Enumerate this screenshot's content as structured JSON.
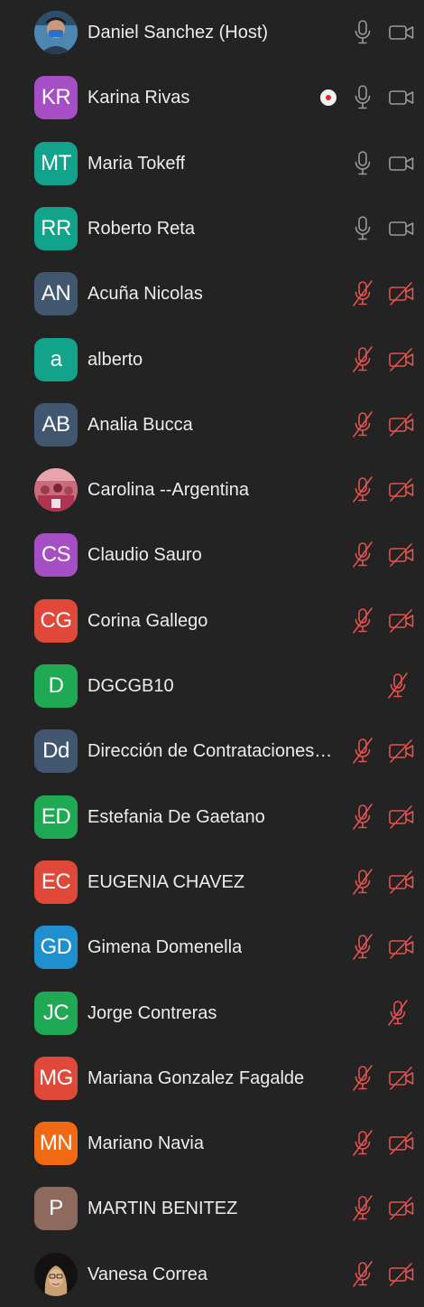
{
  "participants": [
    {
      "name": "Daniel Sanchez (Host)",
      "initials": "",
      "avatar": "photo",
      "color": "#3a6a8a",
      "muted": false,
      "video_off": false,
      "has_video": true,
      "recording": false
    },
    {
      "name": "Karina Rivas",
      "initials": "KR",
      "avatar": "initials",
      "color": "#a64fc4",
      "muted": false,
      "video_off": false,
      "has_video": true,
      "recording": true
    },
    {
      "name": "Maria Tokeff",
      "initials": "MT",
      "avatar": "initials",
      "color": "#12a38a",
      "muted": false,
      "video_off": false,
      "has_video": true,
      "recording": false
    },
    {
      "name": "Roberto Reta",
      "initials": "RR",
      "avatar": "initials",
      "color": "#12a38a",
      "muted": false,
      "video_off": false,
      "has_video": true,
      "recording": false
    },
    {
      "name": "Acuña Nicolas",
      "initials": "AN",
      "avatar": "initials",
      "color": "#41566f",
      "muted": true,
      "video_off": true,
      "has_video": true,
      "recording": false
    },
    {
      "name": "alberto",
      "initials": "a",
      "avatar": "initials",
      "color": "#12a38a",
      "muted": true,
      "video_off": true,
      "has_video": true,
      "recording": false
    },
    {
      "name": "Analia Bucca",
      "initials": "AB",
      "avatar": "initials",
      "color": "#41566f",
      "muted": true,
      "video_off": true,
      "has_video": true,
      "recording": false
    },
    {
      "name": "Carolina --Argentina",
      "initials": "",
      "avatar": "photo",
      "color": "#b3475f",
      "muted": true,
      "video_off": true,
      "has_video": true,
      "recording": false
    },
    {
      "name": "Claudio Sauro",
      "initials": "CS",
      "avatar": "initials",
      "color": "#a64fc4",
      "muted": true,
      "video_off": true,
      "has_video": true,
      "recording": false
    },
    {
      "name": "Corina Gallego",
      "initials": "CG",
      "avatar": "initials",
      "color": "#e0483a",
      "muted": true,
      "video_off": true,
      "has_video": true,
      "recording": false
    },
    {
      "name": "DGCGB10",
      "initials": "D",
      "avatar": "initials",
      "color": "#1fa955",
      "muted": true,
      "video_off": true,
      "has_video": false,
      "recording": false
    },
    {
      "name": "Dirección de Contrataciones…",
      "initials": "Dd",
      "avatar": "initials",
      "color": "#41566f",
      "muted": true,
      "video_off": true,
      "has_video": true,
      "recording": false
    },
    {
      "name": "Estefania De Gaetano",
      "initials": "ED",
      "avatar": "initials",
      "color": "#1fa955",
      "muted": true,
      "video_off": true,
      "has_video": true,
      "recording": false
    },
    {
      "name": "EUGENIA CHAVEZ",
      "initials": "EC",
      "avatar": "initials",
      "color": "#e0483a",
      "muted": true,
      "video_off": true,
      "has_video": true,
      "recording": false
    },
    {
      "name": "Gimena Domenella",
      "initials": "GD",
      "avatar": "initials",
      "color": "#1f8fd0",
      "muted": true,
      "video_off": true,
      "has_video": true,
      "recording": false
    },
    {
      "name": "Jorge Contreras",
      "initials": "JC",
      "avatar": "initials",
      "color": "#1fa955",
      "muted": true,
      "video_off": true,
      "has_video": false,
      "recording": false
    },
    {
      "name": "Mariana Gonzalez Fagalde",
      "initials": "MG",
      "avatar": "initials",
      "color": "#e0483a",
      "muted": true,
      "video_off": true,
      "has_video": true,
      "recording": false
    },
    {
      "name": "Mariano Navia",
      "initials": "MN",
      "avatar": "initials",
      "color": "#ef6a12",
      "muted": true,
      "video_off": true,
      "has_video": true,
      "recording": false
    },
    {
      "name": "MARTIN BENITEZ",
      "initials": "P",
      "avatar": "initials",
      "color": "#8e6a5e",
      "muted": true,
      "video_off": true,
      "has_video": true,
      "recording": false
    },
    {
      "name": "Vanesa Correa",
      "initials": "",
      "avatar": "photo",
      "color": "#2b2420",
      "muted": true,
      "video_off": true,
      "has_video": true,
      "recording": false
    }
  ],
  "colors": {
    "background": "#232323",
    "text": "#ececec",
    "icon_on": "#9a9a9a",
    "icon_muted": "#e5524f",
    "record_dot": "#e02b2b"
  },
  "icons": {
    "mic": "microphone-icon",
    "mic_muted": "microphone-muted-icon",
    "cam": "video-camera-icon",
    "cam_off": "video-camera-off-icon",
    "recording": "recording-icon"
  }
}
